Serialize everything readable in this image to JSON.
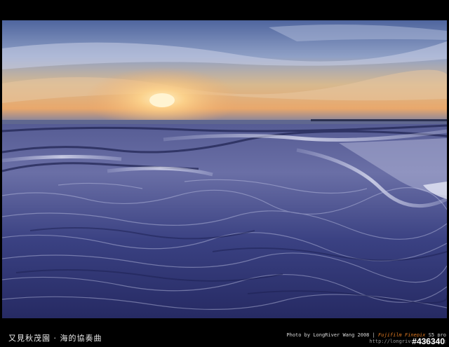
{
  "caption": {
    "title": "又見秋茂園 · 海的協奏曲"
  },
  "credits": {
    "photo_by": "Photo by LongRiver Wang 2008 |",
    "camera": "Fujifilm Finepix",
    "model": "S5 pro",
    "url": "http://longriver.twbbs.org"
  },
  "image_id": "#436340",
  "colors": {
    "frame": "#000000",
    "sky_top": "#5a6fa6",
    "sun": "#ffd28a",
    "sea": "#3d4585",
    "foam": "#d9dcf2"
  }
}
